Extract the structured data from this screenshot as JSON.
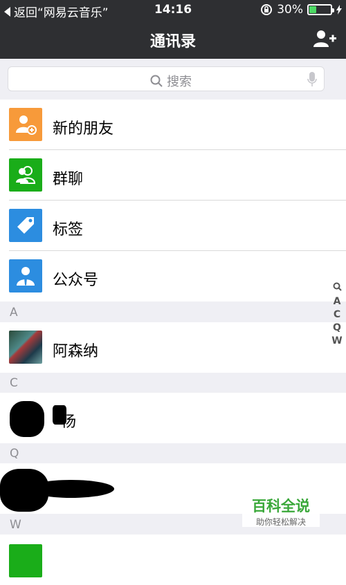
{
  "status": {
    "back_text": "返回“网易云音乐”",
    "time": "14:16",
    "battery": "30%",
    "battery_level": 0.3
  },
  "nav": {
    "title": "通讯录"
  },
  "search": {
    "placeholder": "搜索"
  },
  "menu": [
    {
      "label": "新的朋友",
      "color": "#f79a3a",
      "icon": "add-friend-icon"
    },
    {
      "label": "群聊",
      "color": "#1aad19",
      "icon": "group-chat-icon"
    },
    {
      "label": "标签",
      "color": "#2c8de0",
      "icon": "tag-icon"
    },
    {
      "label": "公众号",
      "color": "#2c8de0",
      "icon": "official-account-icon"
    }
  ],
  "sections": [
    "A",
    "C",
    "Q",
    "W"
  ],
  "contacts": [
    {
      "label": "阿森纳"
    },
    {
      "label": "杨"
    }
  ],
  "index_letters": [
    "A",
    "C",
    "Q",
    "W"
  ],
  "watermark": {
    "title": "百科全说",
    "subtitle": "助你轻松解决"
  }
}
